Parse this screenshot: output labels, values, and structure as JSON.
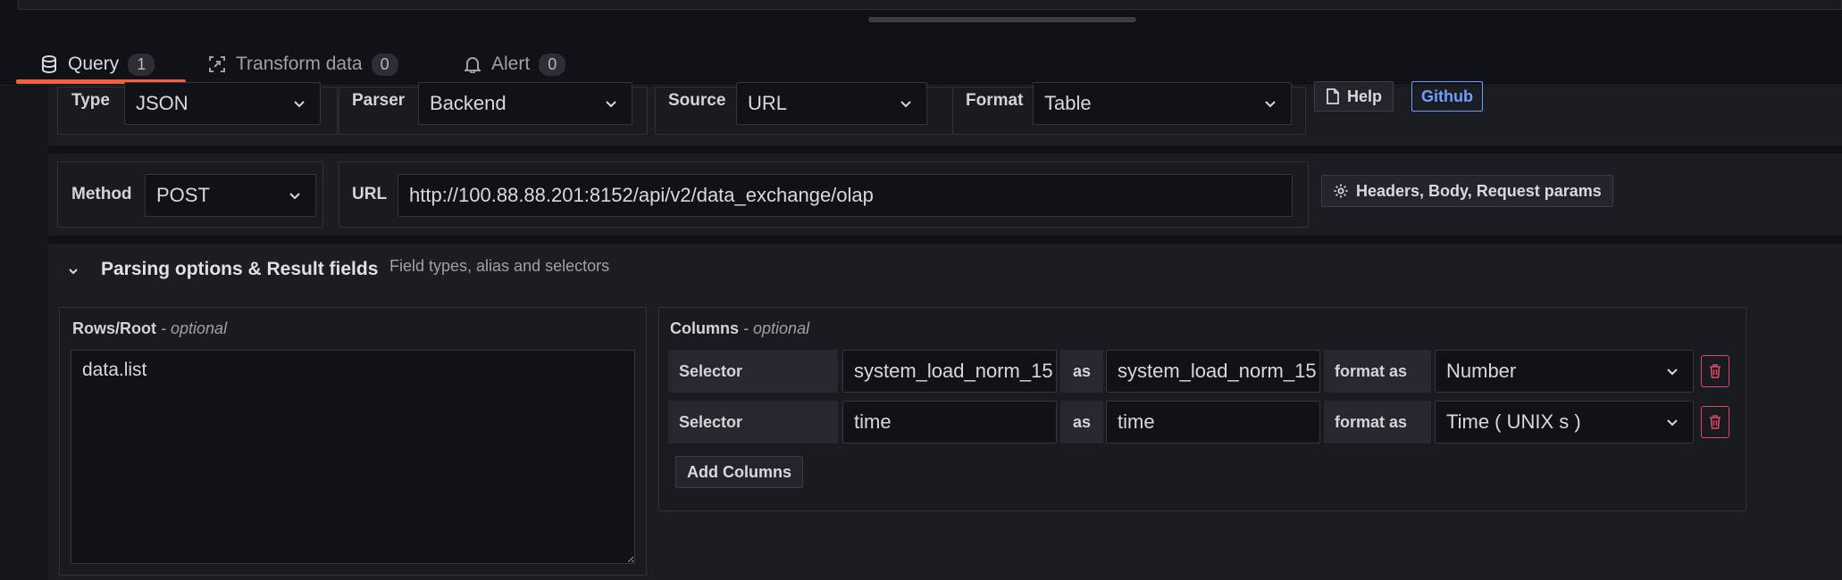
{
  "tabs": [
    {
      "label": "Query",
      "count": "1"
    },
    {
      "label": "Transform data",
      "count": "0"
    },
    {
      "label": "Alert",
      "count": "0"
    }
  ],
  "row1": {
    "type_label": "Type",
    "type_value": "JSON",
    "parser_label": "Parser",
    "parser_value": "Backend",
    "source_label": "Source",
    "source_value": "URL",
    "format_label": "Format",
    "format_value": "Table",
    "help_label": "Help",
    "github_label": "Github"
  },
  "row2": {
    "method_label": "Method",
    "method_value": "POST",
    "url_label": "URL",
    "url_value": "http://100.88.88.201:8152/api/v2/data_exchange/olap",
    "headers_label": "Headers, Body, Request params"
  },
  "parsing": {
    "title": "Parsing options & Result fields",
    "subtitle": "Field types, alias and selectors",
    "rows_root_label": "Rows/Root",
    "optional": "- optional",
    "rows_root_value": "data.list",
    "columns_label": "Columns",
    "columns": [
      {
        "selector_label": "Selector",
        "selector": "system_load_norm_15",
        "as_label": "as",
        "alias": "system_load_norm_15",
        "format_label": "format as",
        "format": "Number"
      },
      {
        "selector_label": "Selector",
        "selector": "time",
        "as_label": "as",
        "alias": "time",
        "format_label": "format as",
        "format": "Time ( UNIX s )"
      }
    ],
    "add_columns_label": "Add Columns"
  },
  "colors": {
    "accent": "#f55f3e",
    "link": "#6e9fff",
    "danger": "#e0456a"
  }
}
